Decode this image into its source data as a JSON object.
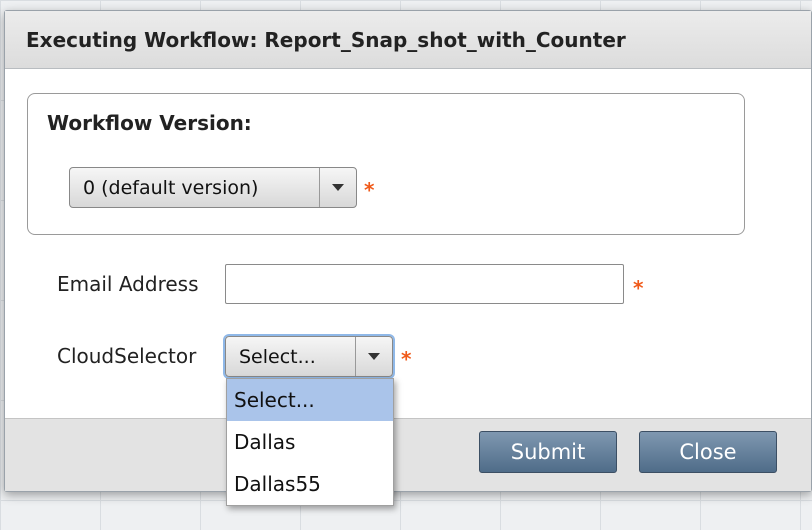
{
  "dialog": {
    "title": "Executing Workflow: Report_Snap_shot_with_Counter"
  },
  "version": {
    "legend": "Workflow Version:",
    "selected": "0  (default version)",
    "required_mark": "*"
  },
  "email": {
    "label": "Email Address",
    "value": "",
    "required_mark": "*"
  },
  "cloud": {
    "label": "CloudSelector",
    "selected": "Select...",
    "required_mark": "*",
    "options": [
      "Select...",
      "Dallas",
      "Dallas55"
    ]
  },
  "footer": {
    "submit_label": "Submit",
    "close_label": "Close"
  },
  "colors": {
    "required": "#f05a1a",
    "button": "#5f7b98",
    "highlight": "#aac4ea"
  }
}
